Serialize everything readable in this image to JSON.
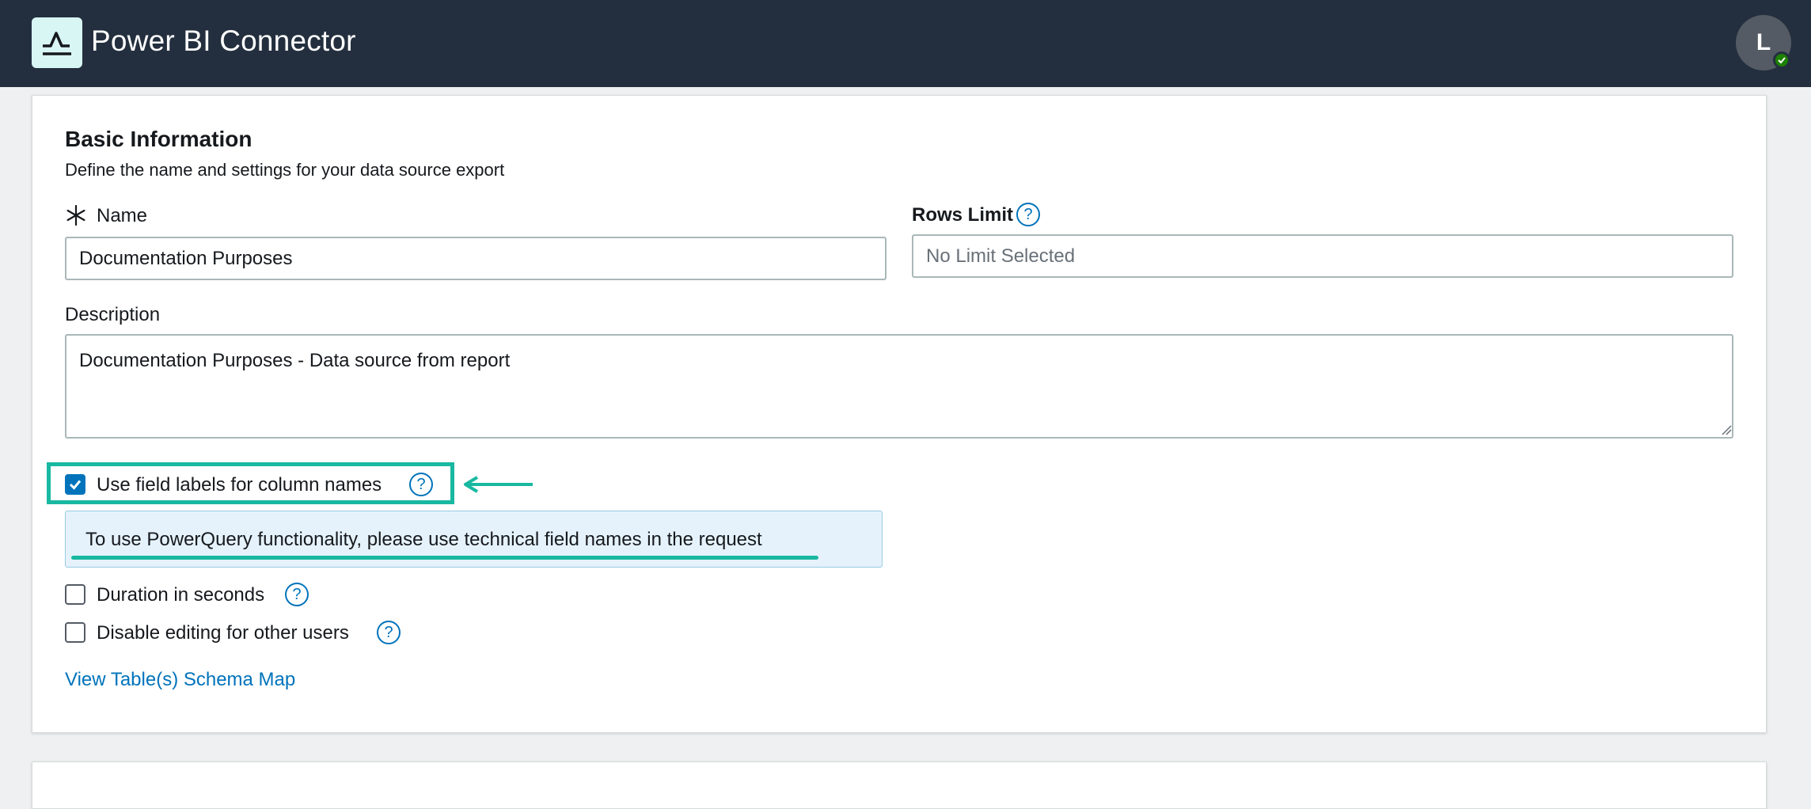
{
  "header": {
    "app_title": "Power BI Connector",
    "logo_icon": "line-chart-logo-icon",
    "avatar_initial": "L",
    "avatar_status": "online",
    "brand_color": "#232f3e",
    "logo_bg": "#d8f7f4"
  },
  "basic_info": {
    "title": "Basic Information",
    "description": "Define the name and settings for your data source export",
    "name_label": "Name",
    "name_required_icon": "asterisk-icon",
    "name_value": "Documentation Purposes",
    "rows_limit_label": "Rows Limit",
    "rows_limit_placeholder": "No Limit Selected",
    "description_label": "Description",
    "description_value": "Documentation Purposes - Data source from report"
  },
  "options": {
    "use_field_labels": {
      "label": "Use field labels for column names",
      "checked": true
    },
    "info_banner": "To use PowerQuery functionality, please use technical field names in the request",
    "duration_in_seconds": {
      "label": "Duration in seconds",
      "checked": false
    },
    "disable_editing": {
      "label": "Disable editing for other users",
      "checked": false
    }
  },
  "links": {
    "schema_map": "View Table(s) Schema Map"
  },
  "colors": {
    "accent": "#0073bb",
    "annotation": "#19b8a0",
    "info_bg": "#e5f2fb"
  }
}
